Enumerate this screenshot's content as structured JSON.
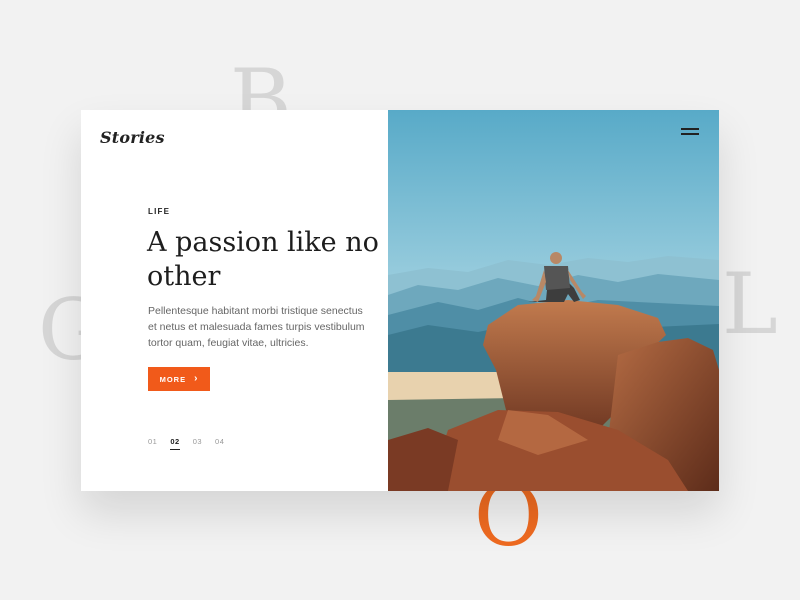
{
  "background_letters": [
    "B",
    "G",
    "L",
    "O"
  ],
  "brand": {
    "logo": "Stories"
  },
  "article": {
    "category": "LIFE",
    "title": "A passion like no other",
    "body": "Pellentesque habitant morbi tristique senectus et netus et malesuada fames turpis vestibulum tortor quam, feugiat vitae, ultricies.",
    "button_label": "MORE"
  },
  "pagination": {
    "pages": [
      "01",
      "02",
      "03",
      "04"
    ],
    "active_index": 1
  },
  "icons": {
    "menu": "hamburger-menu-icon",
    "button_arrow": "chevron-right-icon"
  },
  "colors": {
    "accent": "#f15a1a",
    "accent_letter": "#ee6a20",
    "background": "#f2f2f2",
    "card": "#ffffff",
    "text": "#1d1d1d"
  }
}
